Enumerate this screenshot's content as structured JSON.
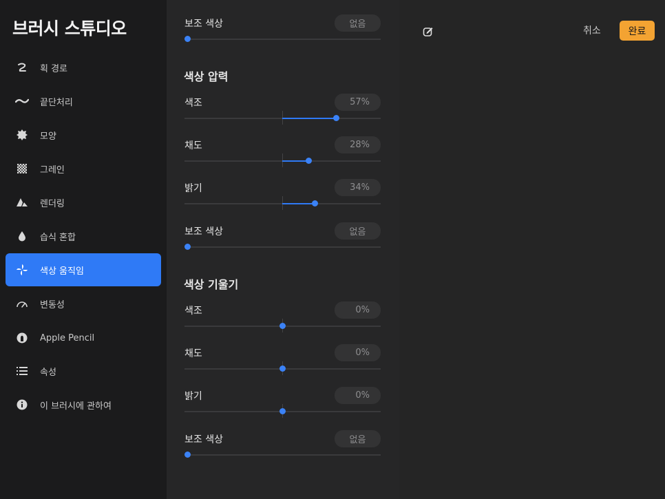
{
  "sidebar": {
    "title": "브러시 스튜디오",
    "items": [
      {
        "label": "획 경로",
        "icon": "stroke-path-icon"
      },
      {
        "label": "끝단처리",
        "icon": "taper-icon"
      },
      {
        "label": "모양",
        "icon": "shape-icon"
      },
      {
        "label": "그레인",
        "icon": "grain-icon"
      },
      {
        "label": "렌더링",
        "icon": "rendering-icon"
      },
      {
        "label": "습식 혼합",
        "icon": "wet-mix-icon"
      },
      {
        "label": "색상 움직임",
        "icon": "color-dynamics-icon",
        "active": true
      },
      {
        "label": "변동성",
        "icon": "dynamics-icon"
      },
      {
        "label": "Apple Pencil",
        "icon": "apple-pencil-icon"
      },
      {
        "label": "속성",
        "icon": "properties-icon"
      },
      {
        "label": "이 브러시에 관하여",
        "icon": "info-icon"
      }
    ]
  },
  "panel": {
    "top_row": {
      "label": "보조 색상",
      "value": "없음",
      "slider": 0.0
    },
    "pressure": {
      "title": "색상 압력",
      "rows": [
        {
          "label": "색조",
          "value": "57%",
          "slider": 0.57
        },
        {
          "label": "채도",
          "value": "28%",
          "slider": 0.28
        },
        {
          "label": "밝기",
          "value": "34%",
          "slider": 0.34
        },
        {
          "label": "보조 색상",
          "value": "없음",
          "slider": 0.0
        }
      ]
    },
    "tilt": {
      "title": "색상 기울기",
      "rows": [
        {
          "label": "색조",
          "value": "0%",
          "slider": 0.0
        },
        {
          "label": "채도",
          "value": "0%",
          "slider": 0.0
        },
        {
          "label": "밝기",
          "value": "0%",
          "slider": 0.0
        },
        {
          "label": "보조 색상",
          "value": "없음",
          "slider": 0.0
        }
      ]
    }
  },
  "toolbar": {
    "cancel_label": "취소",
    "done_label": "완료"
  },
  "colors": {
    "accent": "#2f7af6",
    "done": "#f3a332"
  }
}
